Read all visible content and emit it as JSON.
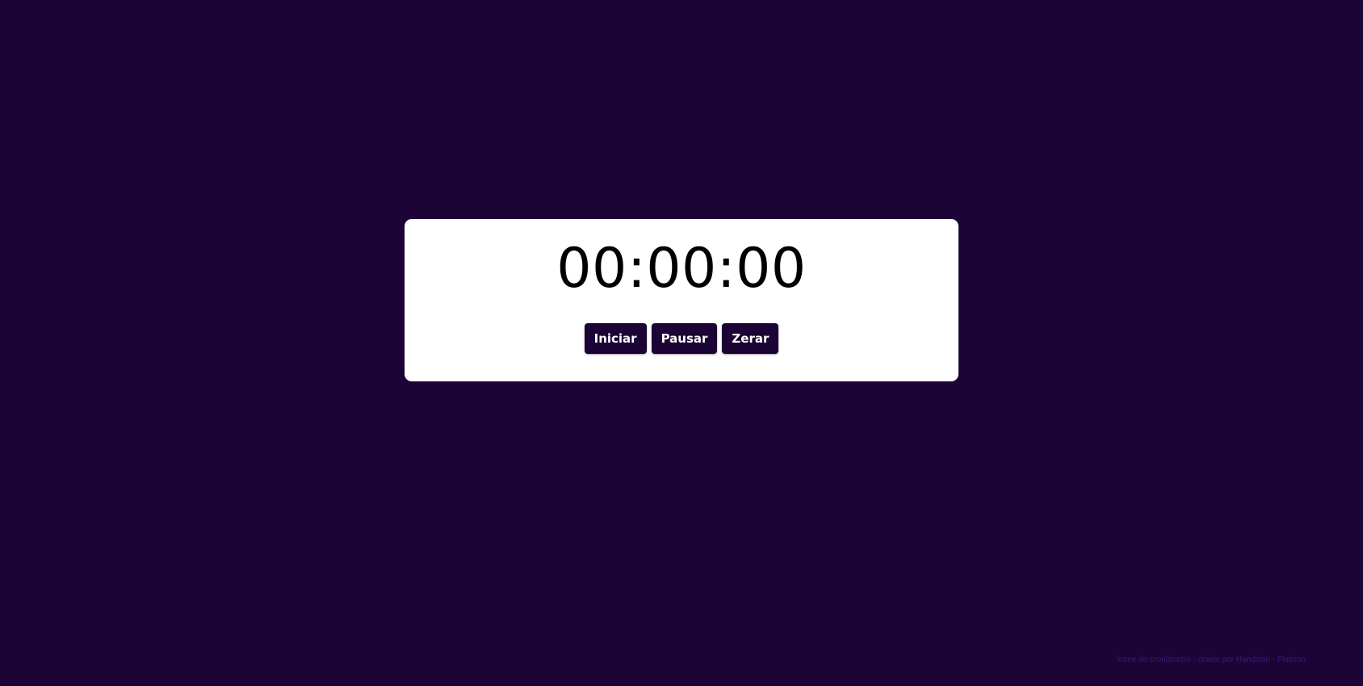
{
  "stopwatch": {
    "time": "00:00:00"
  },
  "controls": {
    "start_label": "Iniciar",
    "pause_label": "Pausar",
    "reset_label": "Zerar"
  },
  "footer": {
    "credit_text": "Ícone do cronômetro - criado por Handicon - Flaticon"
  },
  "colors": {
    "background": "#1c0436",
    "card": "#ffffff",
    "button": "#1c0436",
    "credit": "#3a1a7a"
  }
}
